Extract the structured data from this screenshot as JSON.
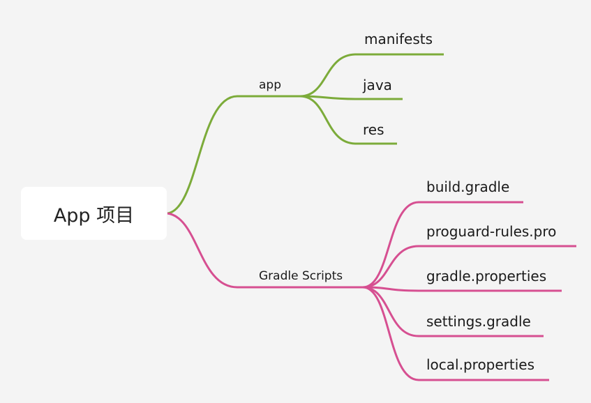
{
  "root": {
    "label": "App 项目"
  },
  "branches": [
    {
      "label": "app",
      "color": "#7cab3a",
      "children": [
        "manifests",
        "java",
        "res"
      ]
    },
    {
      "label": "Gradle Scripts",
      "color": "#d64f91",
      "children": [
        "build.gradle",
        "proguard-rules.pro",
        "gradle.properties",
        "settings.gradle",
        "local.properties"
      ]
    }
  ]
}
